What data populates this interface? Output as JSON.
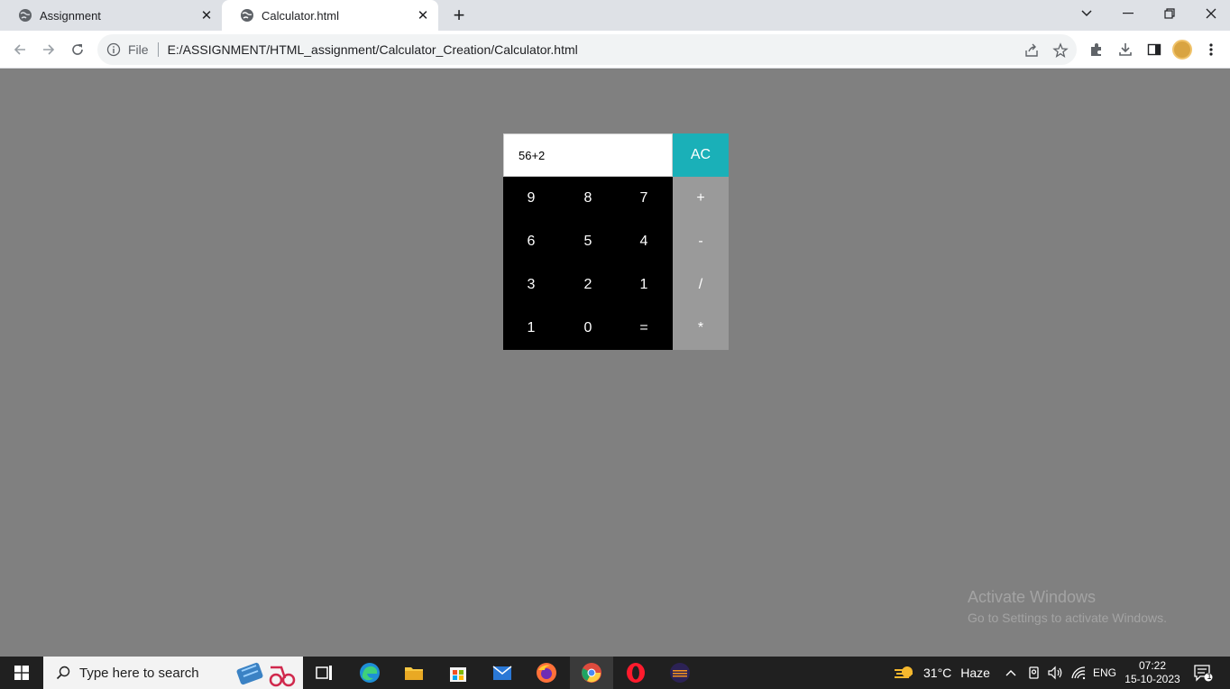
{
  "browser": {
    "tabs": [
      {
        "title": "Assignment",
        "active": false
      },
      {
        "title": "Calculator.html",
        "active": true
      }
    ],
    "new_tab_label": "+",
    "address": {
      "scheme_label": "File",
      "url": "E:/ASSIGNMENT/HTML_assignment/Calculator_Creation/Calculator.html"
    }
  },
  "calculator": {
    "display_value": "56+2",
    "clear_label": "AC",
    "number_rows": [
      [
        "9",
        "8",
        "7"
      ],
      [
        "6",
        "5",
        "4"
      ],
      [
        "3",
        "2",
        "1"
      ],
      [
        "1",
        "0",
        "="
      ]
    ],
    "operators": [
      "+",
      "-",
      "/",
      "*"
    ],
    "colors": {
      "clear_bg": "#1ab0b8",
      "numpad_bg": "#000000",
      "operators_bg": "#9a9a9a",
      "page_bg": "#808080"
    }
  },
  "watermark": {
    "title": "Activate Windows",
    "subtitle": "Go to Settings to activate Windows."
  },
  "taskbar": {
    "search_placeholder": "Type here to search",
    "weather_temp": "31°C",
    "weather_desc": "Haze",
    "language": "ENG",
    "time": "07:22",
    "date": "15-10-2023",
    "notification_count": "1",
    "apps": [
      "widgets-icon",
      "task-view-icon",
      "edge-icon",
      "file-explorer-icon",
      "store-icon",
      "mail-icon",
      "firefox-icon",
      "chrome-icon",
      "opera-icon",
      "eclipse-icon"
    ]
  }
}
